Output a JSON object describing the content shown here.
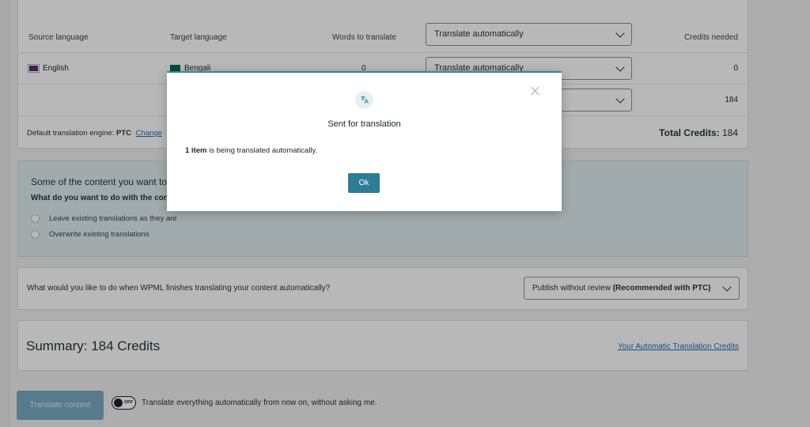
{
  "table": {
    "headers": {
      "source": "Source language",
      "target": "Target language",
      "words": "Words to translate",
      "method": "Translate automatically",
      "credits": "Credits needed"
    },
    "rows": [
      {
        "source": "English",
        "target": "Bengali",
        "words": "0",
        "method": "Translate automatically",
        "credits": "0"
      },
      {
        "source": "",
        "target": "",
        "words": "",
        "method": "",
        "credits": "184"
      }
    ],
    "footer": {
      "engine_label": "Default translation engine:",
      "engine_value": "PTC",
      "change_link": "Change",
      "total_label": "Total Credits:",
      "total_value": "184"
    }
  },
  "notice": {
    "title": "Some of the content you want to",
    "question": "What do you want to do with the cont",
    "options": [
      "Leave existing translations as they are",
      "Overwrite existing translations"
    ]
  },
  "finish": {
    "label": "What would you like to do when WPML finishes translating your content automatically?",
    "select_value": "Publish without review",
    "select_value_bold": "(Recommended with PTC)"
  },
  "summary": {
    "label": "Summary:",
    "value": "184 Credits",
    "link": "Your Automatic Translation Credits"
  },
  "actions": {
    "translate_button": "Translate content",
    "toggle_state": "OFF",
    "toggle_label": "Translate everything automatically from now on, without asking me."
  },
  "modal": {
    "icon": "translate-icon",
    "title": "Sent for translation",
    "msg_bold": "1 item",
    "msg_rest": "is being translated automatically.",
    "ok_label": "Ok"
  },
  "colors": {
    "accent": "#33879e",
    "button": "#2d7d96",
    "link": "#2271b1",
    "notice_bg": "#dfeef0"
  }
}
